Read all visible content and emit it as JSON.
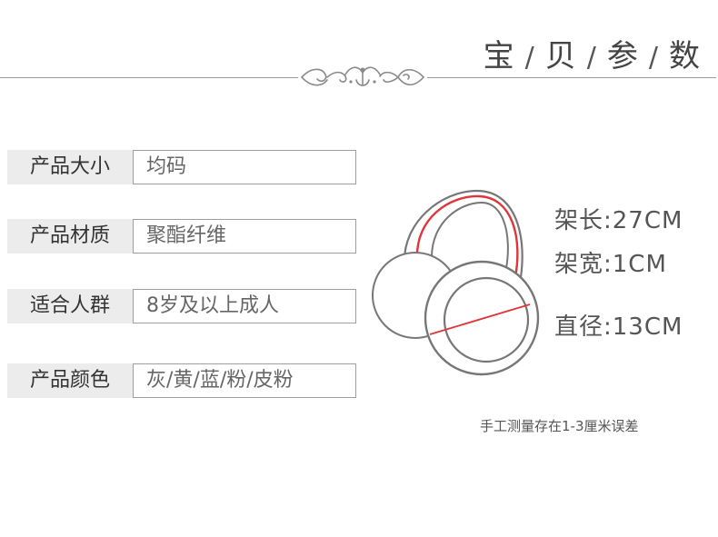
{
  "header": {
    "t1": "宝",
    "t2": "贝",
    "t3": "参",
    "t4": "数",
    "sep": "/"
  },
  "specs": [
    {
      "label": "产品大小",
      "value": "均码"
    },
    {
      "label": "产品材质",
      "value": "聚酯纤维"
    },
    {
      "label": "适合人群",
      "value": "8岁及以上成人"
    },
    {
      "label": "产品颜色",
      "value": "灰/黄/蓝/粉/皮粉"
    }
  ],
  "measurements": {
    "frame_length": "架长:27CM",
    "frame_width": "架宽:1CM",
    "diameter": "直径:13CM"
  },
  "note": "手工测量存在1-3厘米误差",
  "colors": {
    "accent_line": "#e0363a",
    "label_bg": "#ececec",
    "border": "#9f9f9f"
  }
}
